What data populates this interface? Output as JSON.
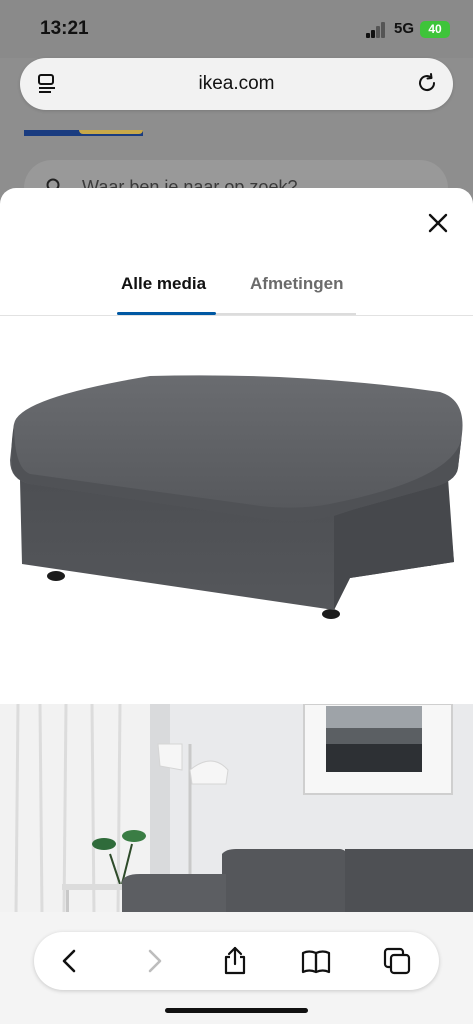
{
  "status_bar": {
    "time": "13:21",
    "network": "5G",
    "battery": "40"
  },
  "browser": {
    "url": "ikea.com"
  },
  "background_page": {
    "search_placeholder": "Waar ben je naar op zoek?"
  },
  "modal": {
    "tabs": [
      {
        "label": "Alle media",
        "active": true
      },
      {
        "label": "Afmetingen",
        "active": false
      }
    ]
  },
  "colors": {
    "accent": "#0058a3",
    "battery": "#3ec43a",
    "sofa": "#55575b"
  },
  "icons": {
    "reader": "reader-mode-icon",
    "reload": "reload-icon",
    "close": "close-icon",
    "back": "back-chevron-icon",
    "forward": "forward-chevron-icon",
    "share": "share-icon",
    "bookmarks": "bookmarks-book-icon",
    "tabs": "tabs-icon"
  }
}
